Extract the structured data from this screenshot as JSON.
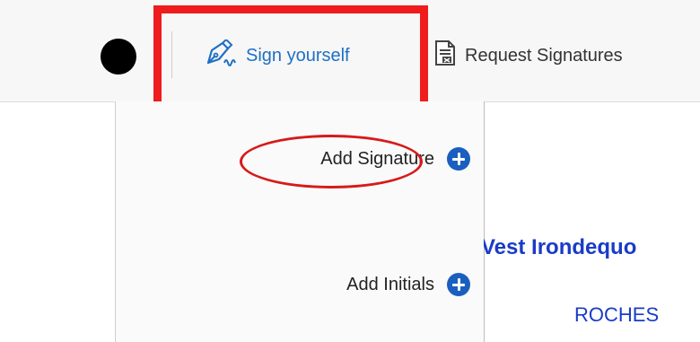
{
  "toolbar": {
    "sign_yourself_label": "Sign yourself",
    "request_signatures_label": "Request Signatures",
    "color_swatch": "#000000",
    "accent_color": "#1f6fc5"
  },
  "menu": {
    "items": [
      {
        "label": "Add Signature",
        "icon": "plus-circle-icon"
      },
      {
        "label": "Add Initials",
        "icon": "plus-circle-icon"
      }
    ]
  },
  "annotations": {
    "highlight_color": "#ee1c1c"
  },
  "document": {
    "heading": "Vest Irondequo",
    "subheading": "ROCHES"
  }
}
